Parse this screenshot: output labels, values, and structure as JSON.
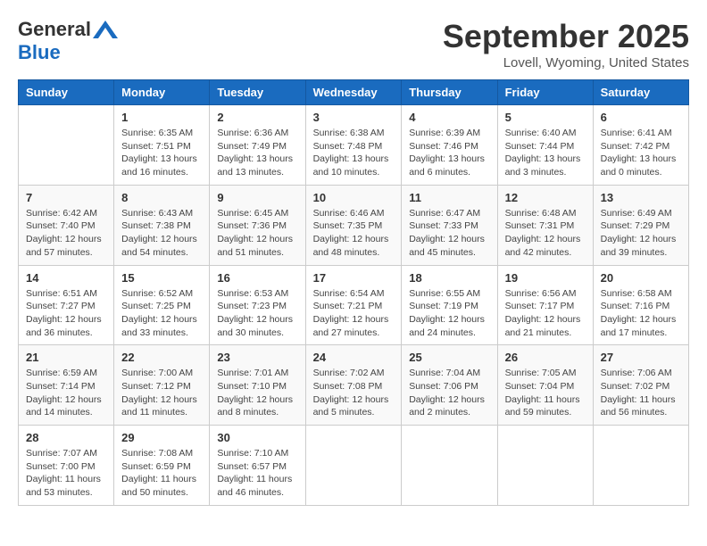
{
  "header": {
    "logo_general": "General",
    "logo_blue": "Blue",
    "month_title": "September 2025",
    "location": "Lovell, Wyoming, United States"
  },
  "days_of_week": [
    "Sunday",
    "Monday",
    "Tuesday",
    "Wednesday",
    "Thursday",
    "Friday",
    "Saturday"
  ],
  "weeks": [
    [
      {
        "day": "",
        "info": ""
      },
      {
        "day": "1",
        "info": "Sunrise: 6:35 AM\nSunset: 7:51 PM\nDaylight: 13 hours\nand 16 minutes."
      },
      {
        "day": "2",
        "info": "Sunrise: 6:36 AM\nSunset: 7:49 PM\nDaylight: 13 hours\nand 13 minutes."
      },
      {
        "day": "3",
        "info": "Sunrise: 6:38 AM\nSunset: 7:48 PM\nDaylight: 13 hours\nand 10 minutes."
      },
      {
        "day": "4",
        "info": "Sunrise: 6:39 AM\nSunset: 7:46 PM\nDaylight: 13 hours\nand 6 minutes."
      },
      {
        "day": "5",
        "info": "Sunrise: 6:40 AM\nSunset: 7:44 PM\nDaylight: 13 hours\nand 3 minutes."
      },
      {
        "day": "6",
        "info": "Sunrise: 6:41 AM\nSunset: 7:42 PM\nDaylight: 13 hours\nand 0 minutes."
      }
    ],
    [
      {
        "day": "7",
        "info": "Sunrise: 6:42 AM\nSunset: 7:40 PM\nDaylight: 12 hours\nand 57 minutes."
      },
      {
        "day": "8",
        "info": "Sunrise: 6:43 AM\nSunset: 7:38 PM\nDaylight: 12 hours\nand 54 minutes."
      },
      {
        "day": "9",
        "info": "Sunrise: 6:45 AM\nSunset: 7:36 PM\nDaylight: 12 hours\nand 51 minutes."
      },
      {
        "day": "10",
        "info": "Sunrise: 6:46 AM\nSunset: 7:35 PM\nDaylight: 12 hours\nand 48 minutes."
      },
      {
        "day": "11",
        "info": "Sunrise: 6:47 AM\nSunset: 7:33 PM\nDaylight: 12 hours\nand 45 minutes."
      },
      {
        "day": "12",
        "info": "Sunrise: 6:48 AM\nSunset: 7:31 PM\nDaylight: 12 hours\nand 42 minutes."
      },
      {
        "day": "13",
        "info": "Sunrise: 6:49 AM\nSunset: 7:29 PM\nDaylight: 12 hours\nand 39 minutes."
      }
    ],
    [
      {
        "day": "14",
        "info": "Sunrise: 6:51 AM\nSunset: 7:27 PM\nDaylight: 12 hours\nand 36 minutes."
      },
      {
        "day": "15",
        "info": "Sunrise: 6:52 AM\nSunset: 7:25 PM\nDaylight: 12 hours\nand 33 minutes."
      },
      {
        "day": "16",
        "info": "Sunrise: 6:53 AM\nSunset: 7:23 PM\nDaylight: 12 hours\nand 30 minutes."
      },
      {
        "day": "17",
        "info": "Sunrise: 6:54 AM\nSunset: 7:21 PM\nDaylight: 12 hours\nand 27 minutes."
      },
      {
        "day": "18",
        "info": "Sunrise: 6:55 AM\nSunset: 7:19 PM\nDaylight: 12 hours\nand 24 minutes."
      },
      {
        "day": "19",
        "info": "Sunrise: 6:56 AM\nSunset: 7:17 PM\nDaylight: 12 hours\nand 21 minutes."
      },
      {
        "day": "20",
        "info": "Sunrise: 6:58 AM\nSunset: 7:16 PM\nDaylight: 12 hours\nand 17 minutes."
      }
    ],
    [
      {
        "day": "21",
        "info": "Sunrise: 6:59 AM\nSunset: 7:14 PM\nDaylight: 12 hours\nand 14 minutes."
      },
      {
        "day": "22",
        "info": "Sunrise: 7:00 AM\nSunset: 7:12 PM\nDaylight: 12 hours\nand 11 minutes."
      },
      {
        "day": "23",
        "info": "Sunrise: 7:01 AM\nSunset: 7:10 PM\nDaylight: 12 hours\nand 8 minutes."
      },
      {
        "day": "24",
        "info": "Sunrise: 7:02 AM\nSunset: 7:08 PM\nDaylight: 12 hours\nand 5 minutes."
      },
      {
        "day": "25",
        "info": "Sunrise: 7:04 AM\nSunset: 7:06 PM\nDaylight: 12 hours\nand 2 minutes."
      },
      {
        "day": "26",
        "info": "Sunrise: 7:05 AM\nSunset: 7:04 PM\nDaylight: 11 hours\nand 59 minutes."
      },
      {
        "day": "27",
        "info": "Sunrise: 7:06 AM\nSunset: 7:02 PM\nDaylight: 11 hours\nand 56 minutes."
      }
    ],
    [
      {
        "day": "28",
        "info": "Sunrise: 7:07 AM\nSunset: 7:00 PM\nDaylight: 11 hours\nand 53 minutes."
      },
      {
        "day": "29",
        "info": "Sunrise: 7:08 AM\nSunset: 6:59 PM\nDaylight: 11 hours\nand 50 minutes."
      },
      {
        "day": "30",
        "info": "Sunrise: 7:10 AM\nSunset: 6:57 PM\nDaylight: 11 hours\nand 46 minutes."
      },
      {
        "day": "",
        "info": ""
      },
      {
        "day": "",
        "info": ""
      },
      {
        "day": "",
        "info": ""
      },
      {
        "day": "",
        "info": ""
      }
    ]
  ]
}
